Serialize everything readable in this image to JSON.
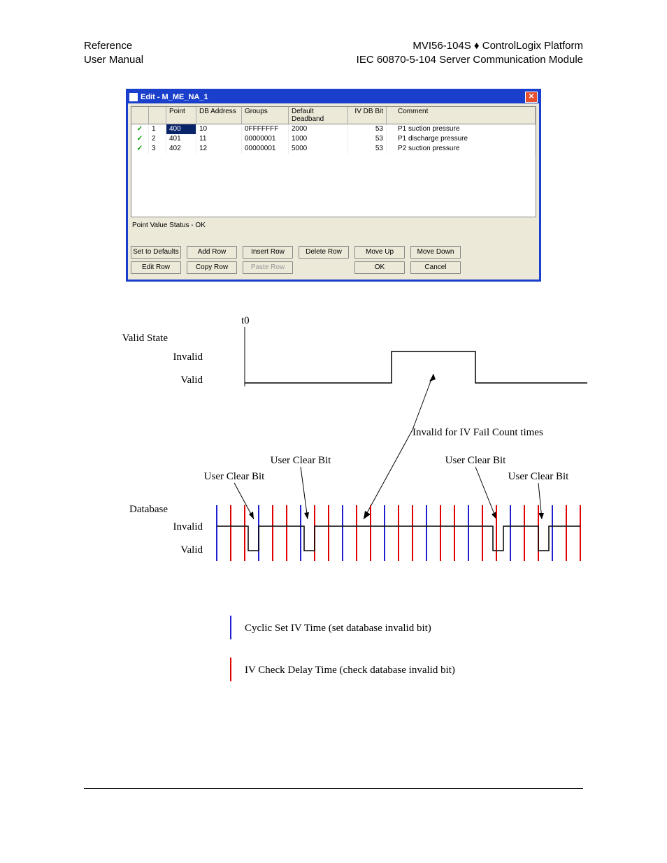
{
  "header": {
    "left_line1": "Reference",
    "left_line2": "User Manual",
    "right_line1": "MVI56-104S ♦ ControlLogix Platform",
    "right_line2": "IEC 60870-5-104 Server Communication Module"
  },
  "dialog": {
    "title": "Edit - M_ME_NA_1",
    "columns": {
      "point": "Point",
      "db": "DB Address",
      "groups": "Groups",
      "deadband": "Default Deadband",
      "iv": "IV DB Bit",
      "comment": "Comment"
    },
    "rows": [
      {
        "idx": "1",
        "point": "400",
        "db": "10",
        "groups": "0FFFFFFF",
        "deadband": "2000",
        "iv": "53",
        "comment": "P1 suction pressure",
        "selected": true
      },
      {
        "idx": "2",
        "point": "401",
        "db": "11",
        "groups": "00000001",
        "deadband": "1000",
        "iv": "53",
        "comment": "P1 discharge pressure",
        "selected": false
      },
      {
        "idx": "3",
        "point": "402",
        "db": "12",
        "groups": "00000001",
        "deadband": "5000",
        "iv": "53",
        "comment": "P2 suction pressure",
        "selected": false
      }
    ],
    "status": "Point Value Status - OK",
    "buttons": {
      "set_defaults": "Set to Defaults",
      "add_row": "Add Row",
      "insert_row": "Insert Row",
      "delete_row": "Delete Row",
      "move_up": "Move Up",
      "move_down": "Move Down",
      "edit_row": "Edit Row",
      "copy_row": "Copy Row",
      "paste_row": "Paste Row",
      "ok": "OK",
      "cancel": "Cancel"
    }
  },
  "diagram": {
    "t0": "t0",
    "valid_state": "Valid State",
    "invalid": "Invalid",
    "valid": "Valid",
    "invalid_for": "Invalid for IV Fail Count times",
    "user_clear_bit": "User Clear Bit",
    "database": "Database",
    "legend_blue": "Cyclic Set IV Time (set database invalid bit)",
    "legend_red": "IV Check Delay Time (check database invalid bit)"
  }
}
